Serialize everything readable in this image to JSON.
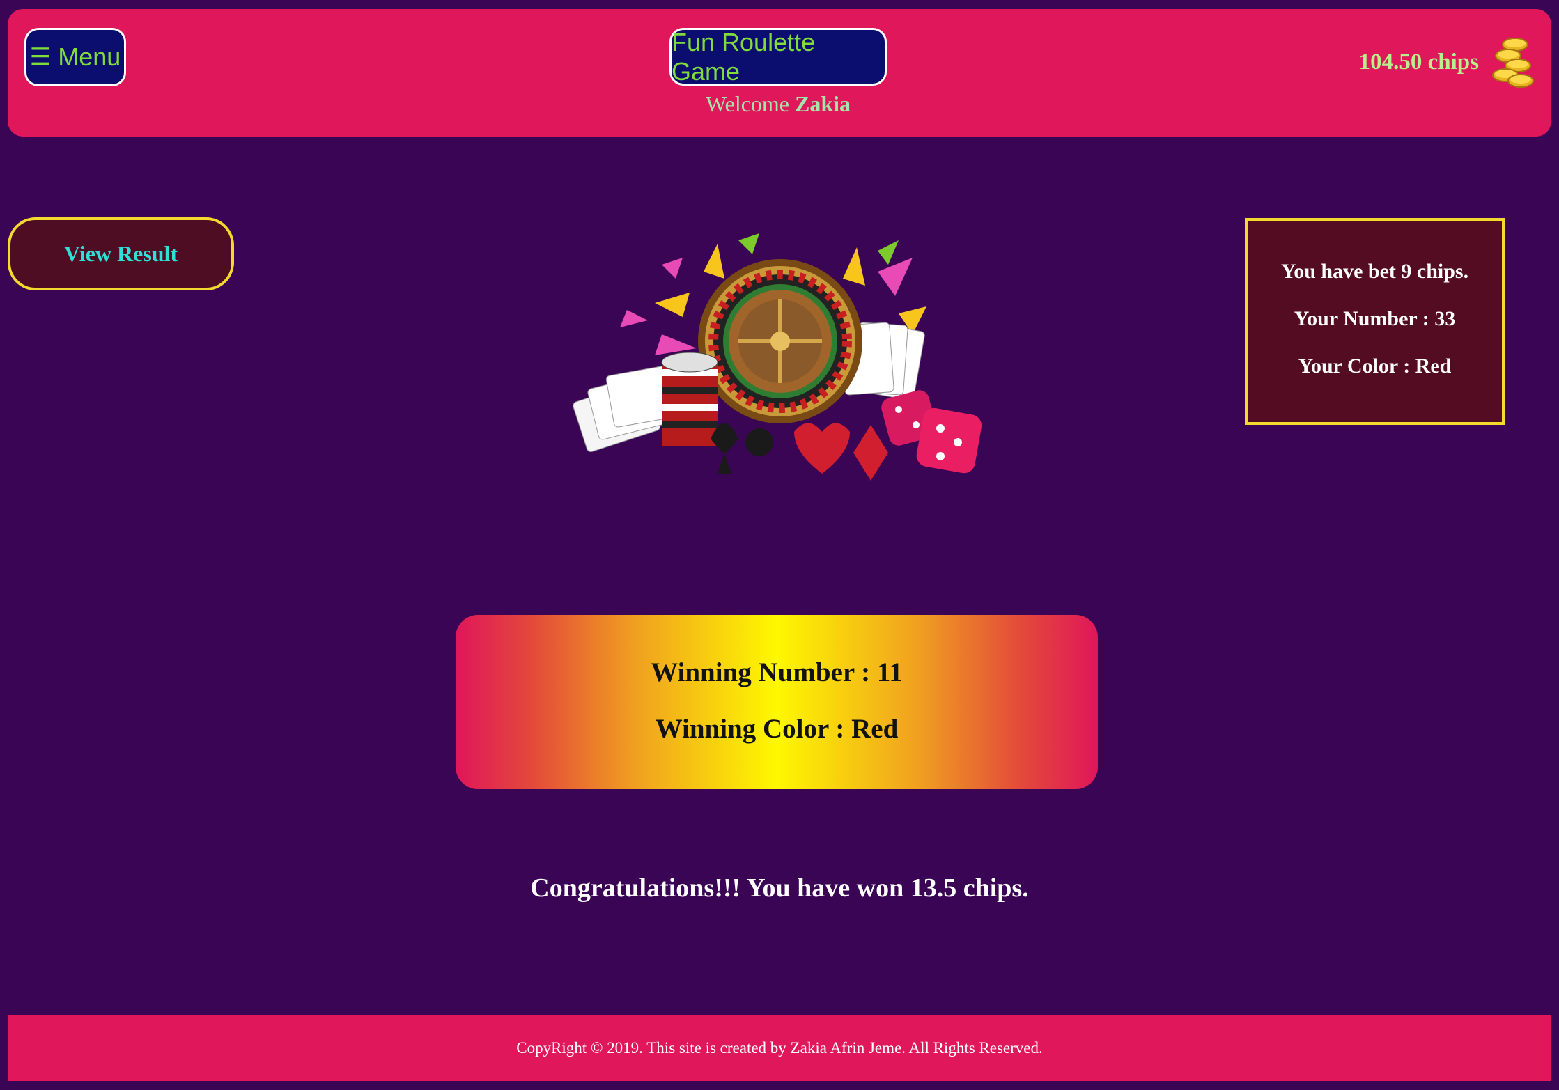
{
  "header": {
    "menu_icon": "☰",
    "menu_label": "Menu",
    "title": "Fun Roulette Game",
    "welcome_prefix": "Welcome",
    "username": "Zakia",
    "chips_balance": "104.50 chips",
    "chips_icon": "coins-icon"
  },
  "actions": {
    "view_result_label": "View Result"
  },
  "bet": {
    "bet_text": "You have bet 9 chips.",
    "your_number": "Your Number : 33",
    "your_color": "Your Color : Red"
  },
  "result": {
    "winning_number": "Winning Number : 11",
    "winning_color": "Winning Color : Red"
  },
  "message": "Congratulations!!! You have won 13.5 chips.",
  "footer": "CopyRight © 2019. This site is created by Zakia Afrin Jeme. All Rights Reserved.",
  "colors": {
    "background": "#3a0555",
    "header_bg": "#e0175a",
    "button_bg": "#0b0e6e",
    "accent_green": "#7fdc3a",
    "border_yellow": "#f4d92e",
    "view_result_text": "#30e0d6"
  }
}
